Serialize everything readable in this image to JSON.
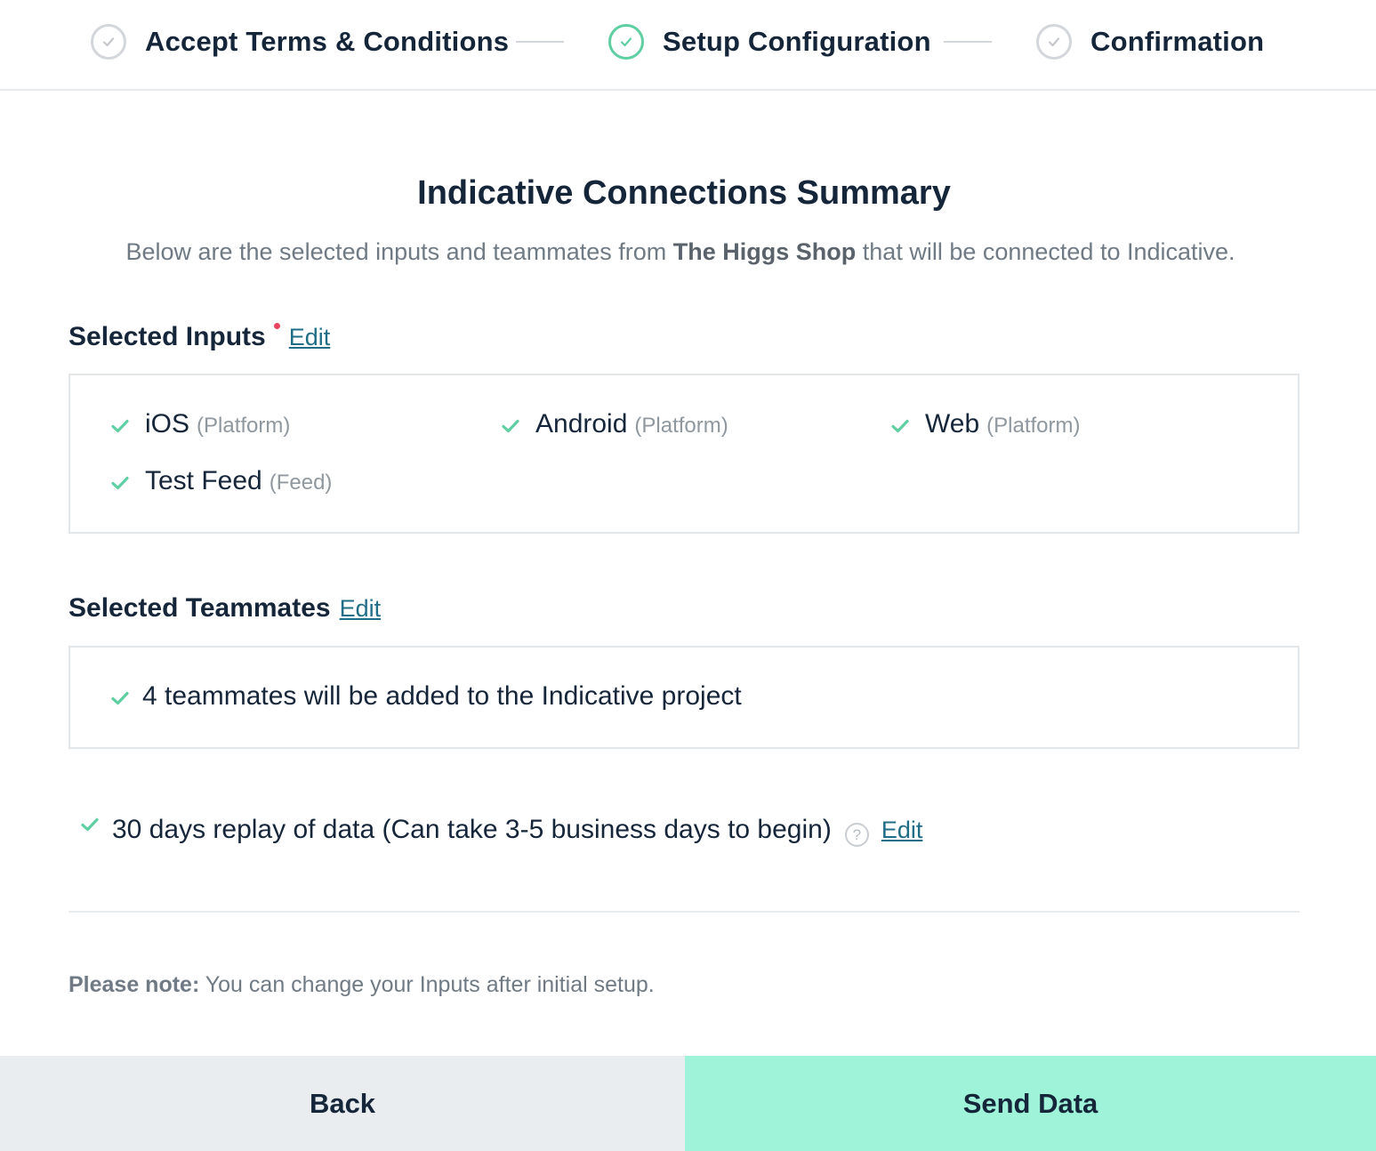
{
  "stepper": {
    "steps": [
      {
        "label": "Accept Terms & Conditions",
        "state": "complete"
      },
      {
        "label": "Setup Configuration",
        "state": "active"
      },
      {
        "label": "Confirmation",
        "state": "complete"
      }
    ]
  },
  "summary": {
    "title": "Indicative Connections Summary",
    "subtitle_before": "Below are the selected inputs and teammates from ",
    "shop_name": "The Higgs Shop",
    "subtitle_after": " that will be connected to Indicative."
  },
  "inputs": {
    "title": "Selected Inputs",
    "edit_label": "Edit",
    "items": [
      {
        "name": "iOS",
        "type": "(Platform)"
      },
      {
        "name": "Android",
        "type": "(Platform)"
      },
      {
        "name": "Web",
        "type": "(Platform)"
      },
      {
        "name": "Test Feed",
        "type": "(Feed)"
      }
    ]
  },
  "teammates": {
    "title": "Selected Teammates",
    "edit_label": "Edit",
    "summary": "4 teammates will be added to the Indicative project"
  },
  "replay": {
    "text": "30 days replay of data (Can take 3-5 business days to begin)",
    "help_glyph": "?",
    "edit_label": "Edit"
  },
  "note": {
    "label": "Please note:",
    "text": " You can change your Inputs after initial setup."
  },
  "footer": {
    "back_label": "Back",
    "send_label": "Send Data"
  },
  "colors": {
    "accent_green": "#5fcfa2",
    "send_button": "#9ef3d9",
    "back_button": "#e9edf0",
    "link": "#1f6d86",
    "required_dot": "#e8445f"
  }
}
